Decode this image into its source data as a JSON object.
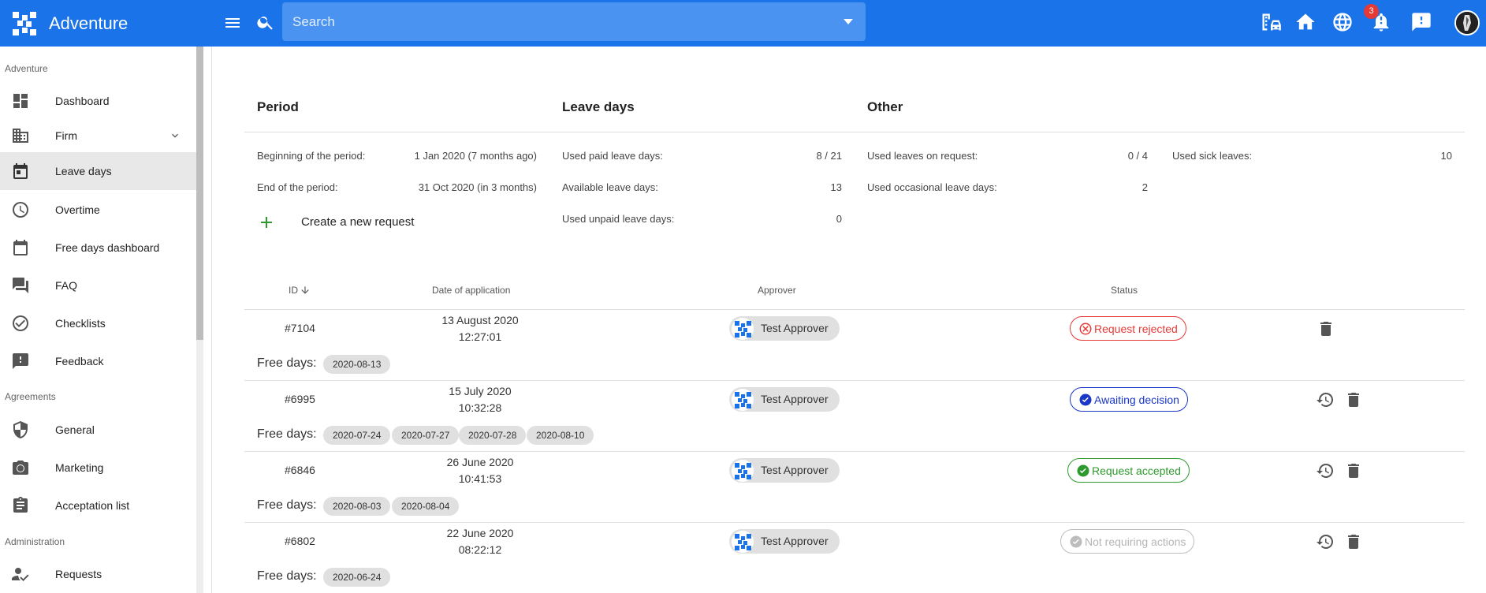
{
  "app": {
    "title": "Adventure"
  },
  "search": {
    "placeholder": "Search"
  },
  "notifications": {
    "count": "3"
  },
  "sidebar": {
    "sections": [
      {
        "label": "Adventure"
      },
      {
        "label": "Agreements"
      },
      {
        "label": "Administration"
      }
    ],
    "items": [
      {
        "label": "Dashboard",
        "icon": "dashboard-icon"
      },
      {
        "label": "Firm",
        "icon": "building-icon"
      },
      {
        "label": "Leave days",
        "icon": "calendar-icon"
      },
      {
        "label": "Overtime",
        "icon": "clock-icon"
      },
      {
        "label": "Free days dashboard",
        "icon": "calendar-blank-icon"
      },
      {
        "label": "FAQ",
        "icon": "forum-icon"
      },
      {
        "label": "Checklists",
        "icon": "check-circle-icon"
      },
      {
        "label": "Feedback",
        "icon": "feedback-icon"
      },
      {
        "label": "General",
        "icon": "shield-icon"
      },
      {
        "label": "Marketing",
        "icon": "camera-icon"
      },
      {
        "label": "Acceptation list",
        "icon": "clipboard-icon"
      },
      {
        "label": "Requests",
        "icon": "person-check-icon"
      }
    ]
  },
  "summary": {
    "period_head": "Period",
    "leave_head": "Leave days",
    "other_head": "Other",
    "begin_label": "Beginning of the period:",
    "begin_value": "1 Jan 2020 (7 months ago)",
    "end_label": "End of the period:",
    "end_value": "31 Oct 2020 (in 3 months)",
    "paid_label": "Used paid leave days:",
    "paid_value": "8 / 21",
    "avail_label": "Available leave days:",
    "avail_value": "13",
    "unpaid_label": "Used unpaid leave days:",
    "unpaid_value": "0",
    "onrequest_label": "Used leaves on request:",
    "onrequest_value": "0 / 4",
    "occasional_label": "Used occasional leave days:",
    "occasional_value": "2",
    "sick_label": "Used sick leaves:",
    "sick_value": "10",
    "create_label": "Create a new request"
  },
  "table": {
    "headers": {
      "id": "ID",
      "date": "Date of application",
      "approver": "Approver",
      "status": "Status"
    },
    "free_days_label": "Free days:",
    "rows": [
      {
        "id": "#7104",
        "date": "13 August 2020",
        "time": "12:27:01",
        "approver": "Test Approver",
        "status": "Request rejected",
        "free_days": [
          "2020-08-13"
        ]
      },
      {
        "id": "#6995",
        "date": "15 July 2020",
        "time": "10:32:28",
        "approver": "Test Approver",
        "status": "Awaiting decision",
        "free_days": [
          "2020-07-24",
          "2020-07-27",
          "2020-07-28",
          "2020-08-10"
        ]
      },
      {
        "id": "#6846",
        "date": "26 June 2020",
        "time": "10:41:53",
        "approver": "Test Approver",
        "status": "Request accepted",
        "free_days": [
          "2020-08-03",
          "2020-08-04"
        ]
      },
      {
        "id": "#6802",
        "date": "22 June 2020",
        "time": "08:22:12",
        "approver": "Test Approver",
        "status": "Not requiring actions",
        "free_days": [
          "2020-06-24"
        ]
      }
    ]
  },
  "colors": {
    "primary": "#1a73e8",
    "rejected": "#e53935",
    "awaiting": "#1a37c8",
    "accepted": "#2e9a2e",
    "none": "#b5b5b5"
  }
}
